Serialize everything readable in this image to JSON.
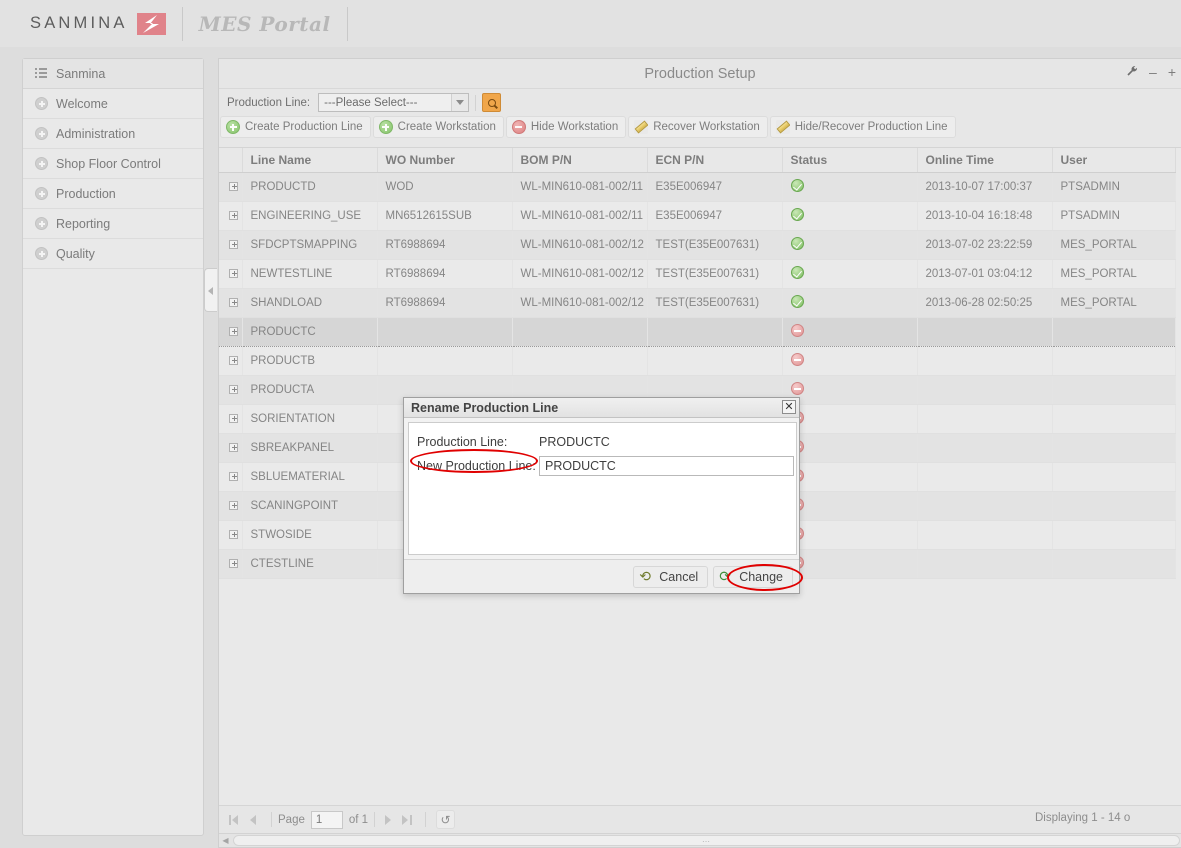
{
  "masthead": {
    "brand": "SANMINA",
    "logo_icon": "sanmina-logo-icon",
    "portal": "MES Portal"
  },
  "sidebar": {
    "items": [
      {
        "label": "Sanmina",
        "icon": "list-icon"
      },
      {
        "label": "Welcome",
        "icon": "plus-circle-icon"
      },
      {
        "label": "Administration",
        "icon": "plus-circle-icon"
      },
      {
        "label": "Shop Floor Control",
        "icon": "plus-circle-icon"
      },
      {
        "label": "Production",
        "icon": "plus-circle-icon"
      },
      {
        "label": "Reporting",
        "icon": "plus-circle-icon"
      },
      {
        "label": "Quality",
        "icon": "plus-circle-icon"
      }
    ]
  },
  "panel": {
    "title": "Production Setup",
    "tools": [
      {
        "name": "wrench-icon",
        "glyph": "⚒"
      },
      {
        "name": "minimize-icon",
        "glyph": "–"
      },
      {
        "name": "maximize-icon",
        "glyph": "+"
      }
    ]
  },
  "toolbar": {
    "production_line_label": "Production Line:",
    "production_line_value": "---Please Select---",
    "search_button_icon": "magnifier-icon",
    "buttons": [
      {
        "label": "Create Production Line",
        "icon": "add-circle-icon",
        "kind": "add"
      },
      {
        "label": "Create Workstation",
        "icon": "add-circle-icon",
        "kind": "add"
      },
      {
        "label": "Hide Workstation",
        "icon": "minus-circle-icon",
        "kind": "minus"
      },
      {
        "label": "Recover Workstation",
        "icon": "pencil-icon",
        "kind": "pencil"
      },
      {
        "label": "Hide/Recover Production Line",
        "icon": "pencil-icon",
        "kind": "pencil"
      }
    ]
  },
  "grid": {
    "columns": [
      "",
      "Line Name",
      "WO Number",
      "BOM P/N",
      "ECN P/N",
      "Status",
      "Online Time",
      "User"
    ],
    "rows": [
      {
        "line_name": "PRODUCTD",
        "wo_number": "WOD",
        "bom_pn": "WL-MIN610-081-002/11",
        "ecn_pn": "E35E006947",
        "status": "ok",
        "online_time": "2013-10-07 17:00:37",
        "user": "PTSADMIN",
        "style": "alt"
      },
      {
        "line_name": "ENGINEERING_USE",
        "wo_number": "MN6512615SUB",
        "bom_pn": "WL-MIN610-081-002/11",
        "ecn_pn": "E35E006947",
        "status": "ok",
        "online_time": "2013-10-04 16:18:48",
        "user": "PTSADMIN",
        "style": "norm"
      },
      {
        "line_name": "SFDCPTSMAPPING",
        "wo_number": "RT6988694",
        "bom_pn": "WL-MIN610-081-002/12",
        "ecn_pn": "TEST(E35E007631)",
        "status": "ok",
        "online_time": "2013-07-02 23:22:59",
        "user": "MES_PORTAL",
        "style": "alt"
      },
      {
        "line_name": "NEWTESTLINE",
        "wo_number": "RT6988694",
        "bom_pn": "WL-MIN610-081-002/12",
        "ecn_pn": "TEST(E35E007631)",
        "status": "ok",
        "online_time": "2013-07-01 03:04:12",
        "user": "MES_PORTAL",
        "style": "norm"
      },
      {
        "line_name": "SHANDLOAD",
        "wo_number": "RT6988694",
        "bom_pn": "WL-MIN610-081-002/12",
        "ecn_pn": "TEST(E35E007631)",
        "status": "ok",
        "online_time": "2013-06-28 02:50:25",
        "user": "MES_PORTAL",
        "style": "alt"
      },
      {
        "line_name": "PRODUCTC",
        "wo_number": "",
        "bom_pn": "",
        "ecn_pn": "",
        "status": "no",
        "online_time": "",
        "user": "",
        "style": "sel"
      },
      {
        "line_name": "PRODUCTB",
        "wo_number": "",
        "bom_pn": "",
        "ecn_pn": "",
        "status": "no",
        "online_time": "",
        "user": "",
        "style": "norm"
      },
      {
        "line_name": "PRODUCTA",
        "wo_number": "",
        "bom_pn": "",
        "ecn_pn": "",
        "status": "no",
        "online_time": "",
        "user": "",
        "style": "alt"
      },
      {
        "line_name": "SORIENTATION",
        "wo_number": "",
        "bom_pn": "",
        "ecn_pn": "",
        "status": "no",
        "online_time": "",
        "user": "",
        "style": "norm"
      },
      {
        "line_name": "SBREAKPANEL",
        "wo_number": "",
        "bom_pn": "",
        "ecn_pn": "",
        "status": "no",
        "online_time": "",
        "user": "",
        "style": "alt"
      },
      {
        "line_name": "SBLUEMATERIAL",
        "wo_number": "",
        "bom_pn": "",
        "ecn_pn": "",
        "status": "no",
        "online_time": "",
        "user": "",
        "style": "norm"
      },
      {
        "line_name": "SCANINGPOINT",
        "wo_number": "",
        "bom_pn": "",
        "ecn_pn": "",
        "status": "no",
        "online_time": "",
        "user": "",
        "style": "alt"
      },
      {
        "line_name": "STWOSIDE",
        "wo_number": "",
        "bom_pn": "",
        "ecn_pn": "",
        "status": "no",
        "online_time": "",
        "user": "",
        "style": "norm"
      },
      {
        "line_name": "CTESTLINE",
        "wo_number": "",
        "bom_pn": "",
        "ecn_pn": "",
        "status": "no",
        "online_time": "",
        "user": "",
        "style": "alt"
      }
    ]
  },
  "pager": {
    "first_icon": "first-page-icon",
    "prev_icon": "prev-page-icon",
    "page_label": "Page",
    "page_value": "1",
    "of_label": "of 1",
    "next_icon": "next-page-icon",
    "last_icon": "last-page-icon",
    "refresh_icon": "refresh-icon",
    "displaying": "Displaying 1 - 14 o"
  },
  "modal": {
    "title": "Rename Production Line",
    "close_icon": "close-icon",
    "production_line_label": "Production Line:",
    "production_line_value": "PRODUCTC",
    "new_production_line_label": "New Production Line:",
    "new_production_line_value": "PRODUCTC",
    "cancel_label": "Cancel",
    "cancel_icon": "refresh-arrow-icon",
    "change_label": "Change",
    "change_icon": "refresh-arrow-icon"
  },
  "annotations": {
    "color": "#e00000",
    "highlights": [
      "new-production-line-label",
      "change-button"
    ]
  }
}
